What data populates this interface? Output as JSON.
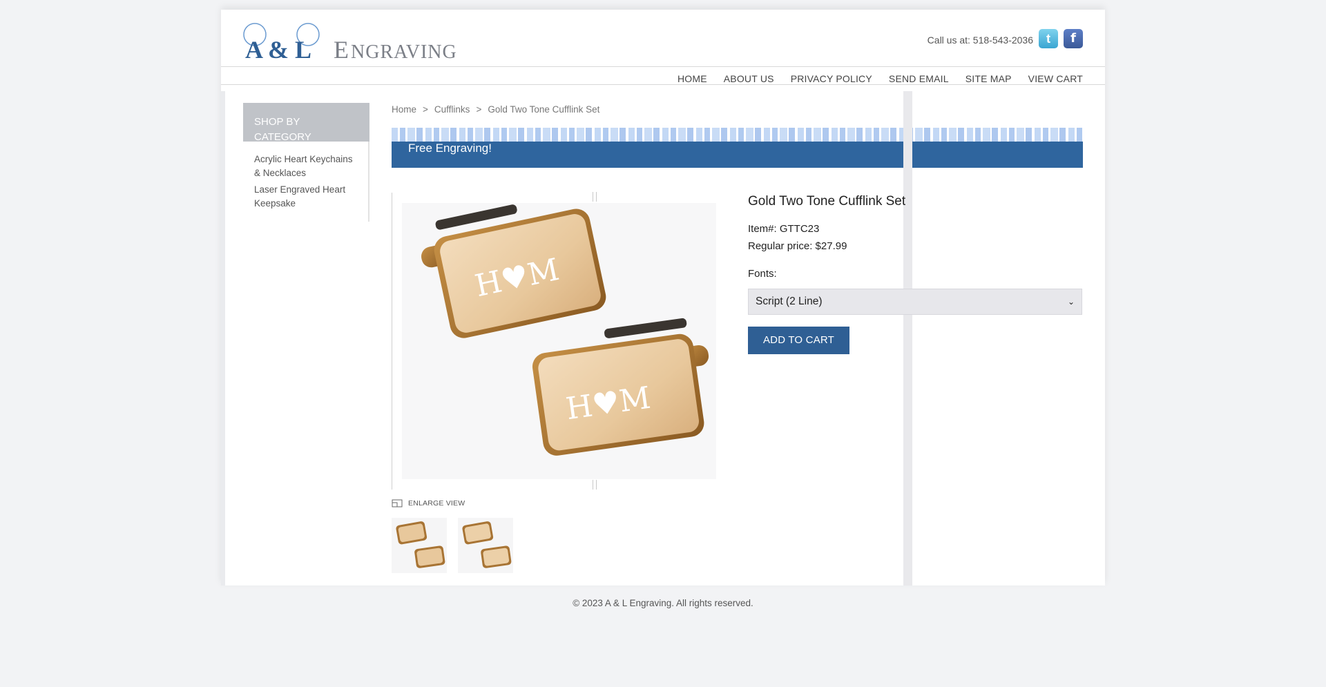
{
  "brand": {
    "logo_monogram": "A & L",
    "logo_word": "Engraving"
  },
  "header": {
    "contact": "Call us at: 518-543-2036",
    "twitter_icon": "twitter-icon",
    "facebook_icon": "facebook-icon"
  },
  "nav": [
    "HOME",
    "ABOUT US",
    "PRIVACY POLICY",
    "SEND EMAIL",
    "SITE MAP",
    "VIEW CART"
  ],
  "sidebar": {
    "heading": "SHOP BY CATEGORY",
    "items": [
      "Acrylic Heart Keychains & Necklaces",
      "Laser Engraved Heart Keepsake"
    ]
  },
  "breadcrumb": [
    "Home",
    "Cufflinks",
    "Gold Two Tone Cufflink Set"
  ],
  "breadcrumb_sep": ">",
  "banner": "Free Engraving!",
  "product": {
    "title": "Gold Two Tone Cufflink Set",
    "item": "Item#: GTTC23",
    "price": "Regular price: $27.99",
    "fonts_label": "Fonts:",
    "font_selected": "Script (2 Line)",
    "add_to_cart": "ADD TO CART",
    "enlarge": "ENLARGE VIEW",
    "engraving_text": "H♥M"
  },
  "footer": "© 2023 A & L Engraving. All rights reserved.",
  "colors": {
    "accent": "#2f659e",
    "button": "#2f5f94",
    "sidebar_head": "#c0c3c8",
    "gold": "#e8c89c"
  }
}
